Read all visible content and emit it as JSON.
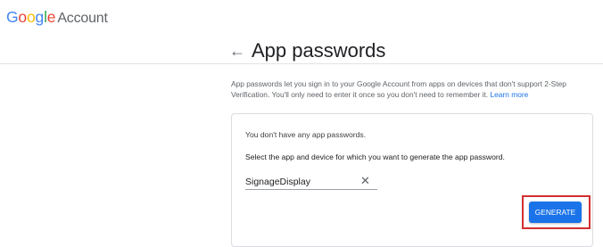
{
  "header": {
    "logo_letters": [
      "G",
      "o",
      "o",
      "g",
      "l",
      "e"
    ],
    "logo_colors": [
      "#4285F4",
      "#EA4335",
      "#FBBC05",
      "#4285F4",
      "#34A853",
      "#EA4335"
    ],
    "logo_suffix": "Account"
  },
  "page": {
    "back_icon": "←",
    "title": "App passwords",
    "description": "App passwords let you sign in to your Google Account from apps on devices that don't support 2-Step Verification. You'll only need to enter it once so you don't need to remember it.",
    "learn_more": "Learn more"
  },
  "card": {
    "no_passwords": "You don't have any app passwords.",
    "select_prompt": "Select the app and device for which you want to generate the app password.",
    "app_name_value": "SignageDisplay",
    "clear_icon": "✕",
    "generate_label": "GENERATE"
  },
  "colors": {
    "accent": "#1a73e8",
    "highlight": "#d32f2f"
  }
}
